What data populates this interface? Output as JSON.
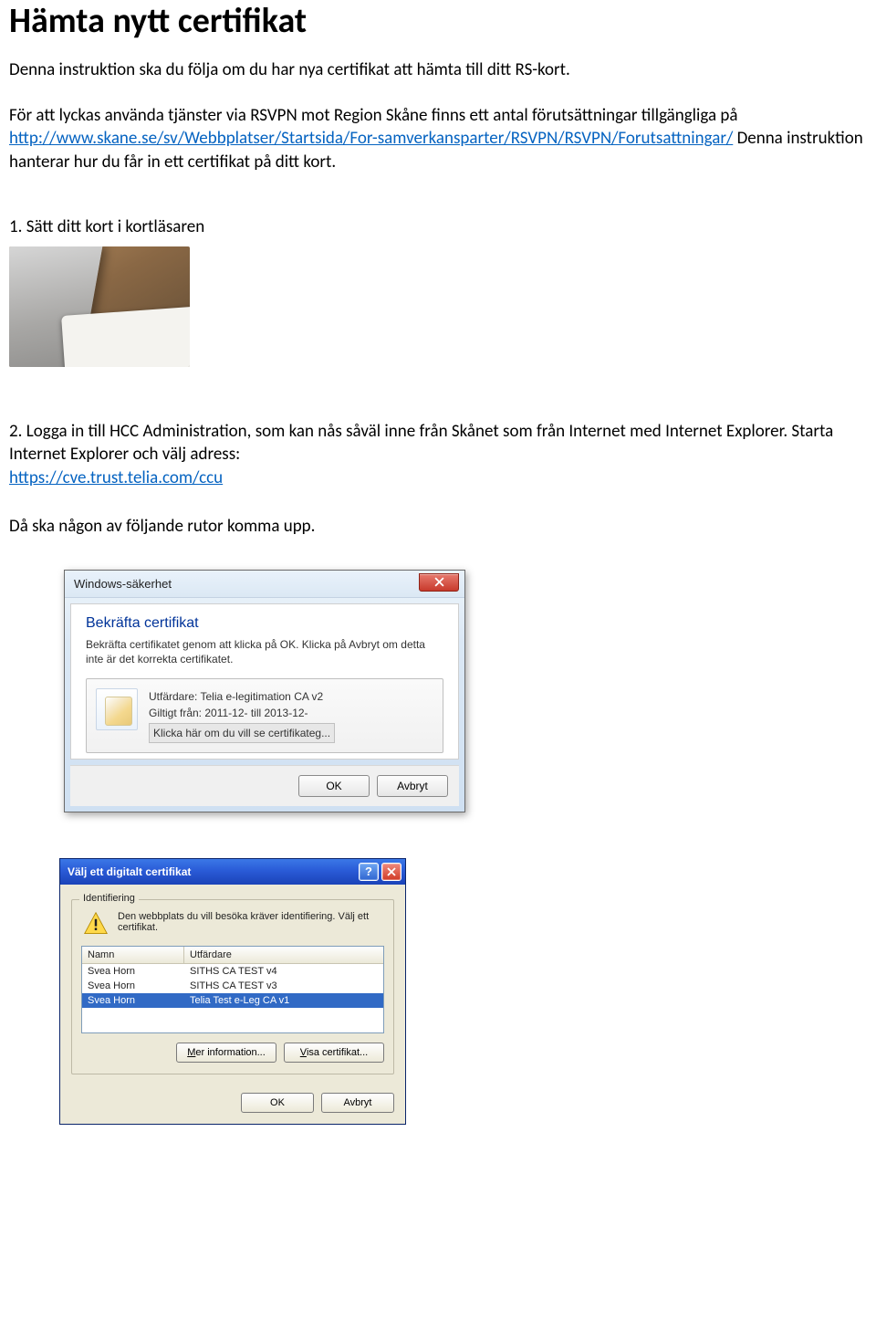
{
  "title": "Hämta nytt certifikat",
  "intro1": "Denna instruktion ska du följa om du har nya certifikat att hämta till ditt RS-kort.",
  "intro2_prefix": "För att lyckas använda tjänster via RSVPN mot Region Skåne finns ett antal förutsättningar tillgängliga på ",
  "intro2_link": "http://www.skane.se/sv/Webbplatser/Startsida/For-samverkansparter/RSVPN/RSVPN/Forutsattningar/",
  "intro2_suffix": " Denna instruktion hanterar hur du får in ett certifikat på ditt kort.",
  "step1": "1.   Sätt ditt kort i kortläsaren",
  "step2a": "2.   Logga in till HCC Administration, som kan nås såväl inne från Skånet som från Internet med Internet Explorer. Starta Internet Explorer och välj adress: ",
  "step2_link": "https://cve.trust.telia.com/ccu",
  "outro": "Då ska någon av följande rutor komma upp.",
  "win7": {
    "window_title": "Windows-säkerhet",
    "heading": "Bekräfta certifikat",
    "sub": "Bekräfta certifikatet genom att klicka på OK. Klicka på Avbryt om detta inte är det korrekta certifikatet.",
    "issuer_label": "Utfärdare: Telia e-legitimation CA v2",
    "valid_label": "Giltigt från: 2011-12-     till 2013-12-",
    "more_label": "Klicka här om du vill se certifikateg...",
    "ok": "OK",
    "cancel": "Avbryt"
  },
  "xp": {
    "window_title": "Välj ett digitalt certifikat",
    "legend": "Identifiering",
    "msg": "Den webbplats du vill besöka kräver identifiering. Välj ett certifikat.",
    "col_name": "Namn",
    "col_issuer": "Utfärdare",
    "rows": [
      {
        "name": "Svea Horn",
        "issuer": "SITHS CA TEST v4"
      },
      {
        "name": "Svea Horn",
        "issuer": "SITHS CA TEST v3"
      },
      {
        "name": "Svea Horn",
        "issuer": "Telia Test e-Leg CA v1"
      }
    ],
    "more_info_full": "Mer information...",
    "view_cert_full": "Visa certifikat...",
    "ok": "OK",
    "cancel": "Avbryt"
  }
}
